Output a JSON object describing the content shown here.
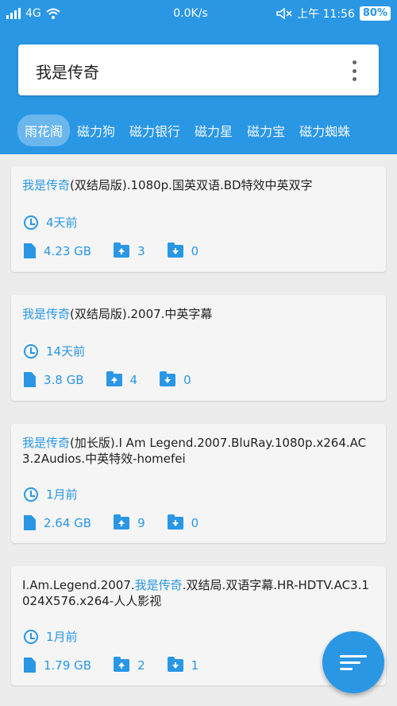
{
  "status": {
    "network": "4G",
    "speed": "0.0K/s",
    "time": "上午 11:56",
    "battery": "80%"
  },
  "search": {
    "query": "我是传奇"
  },
  "tabs": [
    {
      "label": "雨花阁",
      "active": true
    },
    {
      "label": "磁力狗"
    },
    {
      "label": "磁力银行"
    },
    {
      "label": "磁力星"
    },
    {
      "label": "磁力宝"
    },
    {
      "label": "磁力蜘蛛"
    }
  ],
  "results": [
    {
      "title_prefix": "",
      "title_highlight": "我是传奇",
      "title_suffix": "(双结局版).1080p.国英双语.BD特效中英双字",
      "age": "4天前",
      "size": "4.23 GB",
      "seeders": "3",
      "leechers": "0"
    },
    {
      "title_prefix": "",
      "title_highlight": "我是传奇",
      "title_suffix": "(双结局版).2007.中英字幕",
      "age": "14天前",
      "size": "3.8 GB",
      "seeders": "4",
      "leechers": "0"
    },
    {
      "title_prefix": "",
      "title_highlight": "我是传奇",
      "title_suffix": "(加长版).I Am Legend.2007.BluRay.1080p.x264.AC3.2Audios.中英特效-homefei",
      "age": "1月前",
      "size": "2.64 GB",
      "seeders": "9",
      "leechers": "0"
    },
    {
      "title_prefix": "I.Am.Legend.2007.",
      "title_highlight": "我是传奇",
      "title_suffix": ".双结局.双语字幕.HR-HDTV.AC3.1024X576.x264-人人影视",
      "age": "1月前",
      "size": "1.79 GB",
      "seeders": "2",
      "leechers": "1"
    }
  ]
}
